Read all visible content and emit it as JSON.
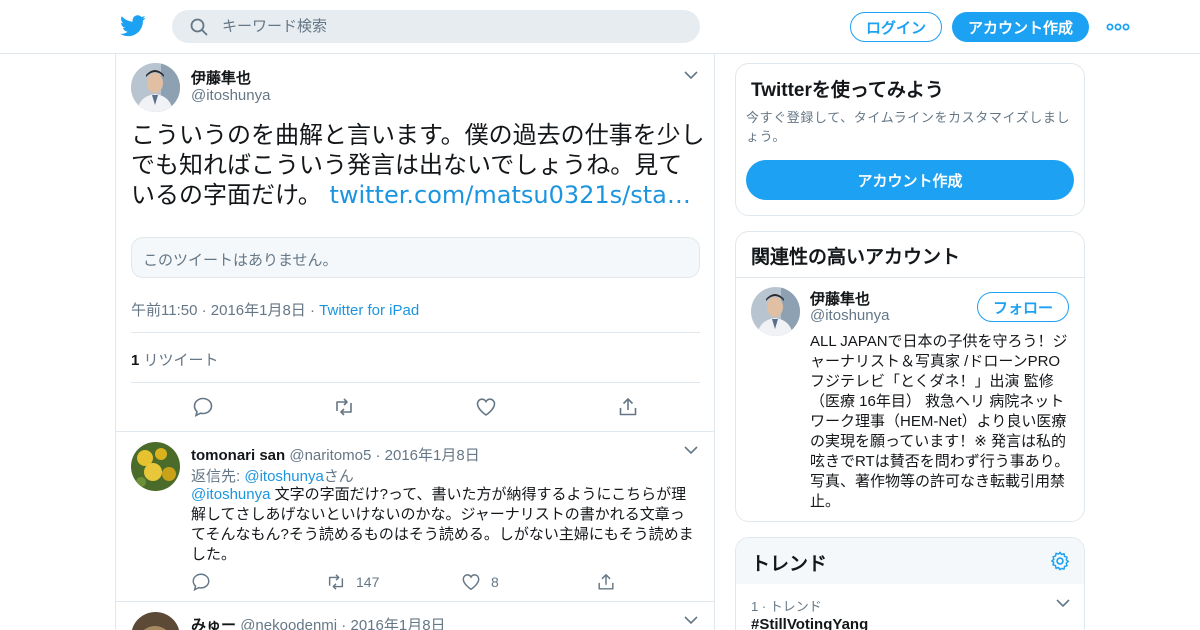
{
  "header": {
    "search_placeholder": "キーワード検索",
    "login_label": "ログイン",
    "signup_label": "アカウント作成",
    "icons": [
      "twitter-bird-icon",
      "search-icon",
      "more-icon"
    ]
  },
  "tweet": {
    "author_name": "伊藤隼也",
    "author_handle": "@itoshunya",
    "text": "こういうのを曲解と言います。僕の過去の仕事を少しでも知ればこういう発言は出ないでしょうね。見ているの字面だけ。 ",
    "link": "twitter.com/matsu0321s/sta…",
    "quote_unavailable": "このツイートはありません。",
    "timestamp": "午前11:50 · 2016年1月8日",
    "meta_sep": " · ",
    "source": "Twitter for iPad",
    "retweet_count": "1",
    "retweet_label": " リツイート"
  },
  "replies": [
    {
      "name": "tomonari san",
      "handle": "@naritomo5",
      "sep": " · ",
      "date": "2016年1月8日",
      "reply_to_label": "返信先: ",
      "reply_to_handle": "@itoshunya",
      "reply_to_suffix": "さん",
      "mention": "@itoshunya",
      "text": " 文字の字面だけ?って、書いた方が納得するようにこちらが理解してさしあげないといけないのかな。ジャーナリストの書かれる文章ってそんなもん?そう読めるものはそう読める。しがない主婦にもそう読めました。",
      "retweets": "147",
      "likes": "8"
    },
    {
      "name": "みゅー",
      "handle": "@nekoodenmi",
      "sep": " · ",
      "date": "2016年1月8日"
    }
  ],
  "sidebar": {
    "signup_card": {
      "title": "Twitterを使ってみよう",
      "subtitle": "今すぐ登録して、タイムラインをカスタマイズしましょう。",
      "button": "アカウント作成"
    },
    "related": {
      "title": "関連性の高いアカウント",
      "name": "伊藤隼也",
      "handle": "@itoshunya",
      "follow_label": "フォロー",
      "bio": "ALL JAPANで日本の子供を守ろう！ジャーナリスト＆写真家 /ドローンPRO フジテレビ「とくダネ！」出演 監修（医療 16年目） 救急ヘリ 病院ネットワーク理事（HEM-Net）より良い医療の実現を願っています！※ 発言は私的呟きでRTは賛否を問わず行う事あり。写真、著作物等の許可なき転載引用禁止。"
    },
    "trends": {
      "title": "トレンド",
      "items": [
        {
          "rank_label": "1 · トレンド",
          "name": "#StillVotingYang"
        }
      ]
    }
  },
  "colors": {
    "accent": "#1da1f2",
    "link": "#1b95e0",
    "muted": "#657786",
    "border": "#e1e8ed"
  }
}
